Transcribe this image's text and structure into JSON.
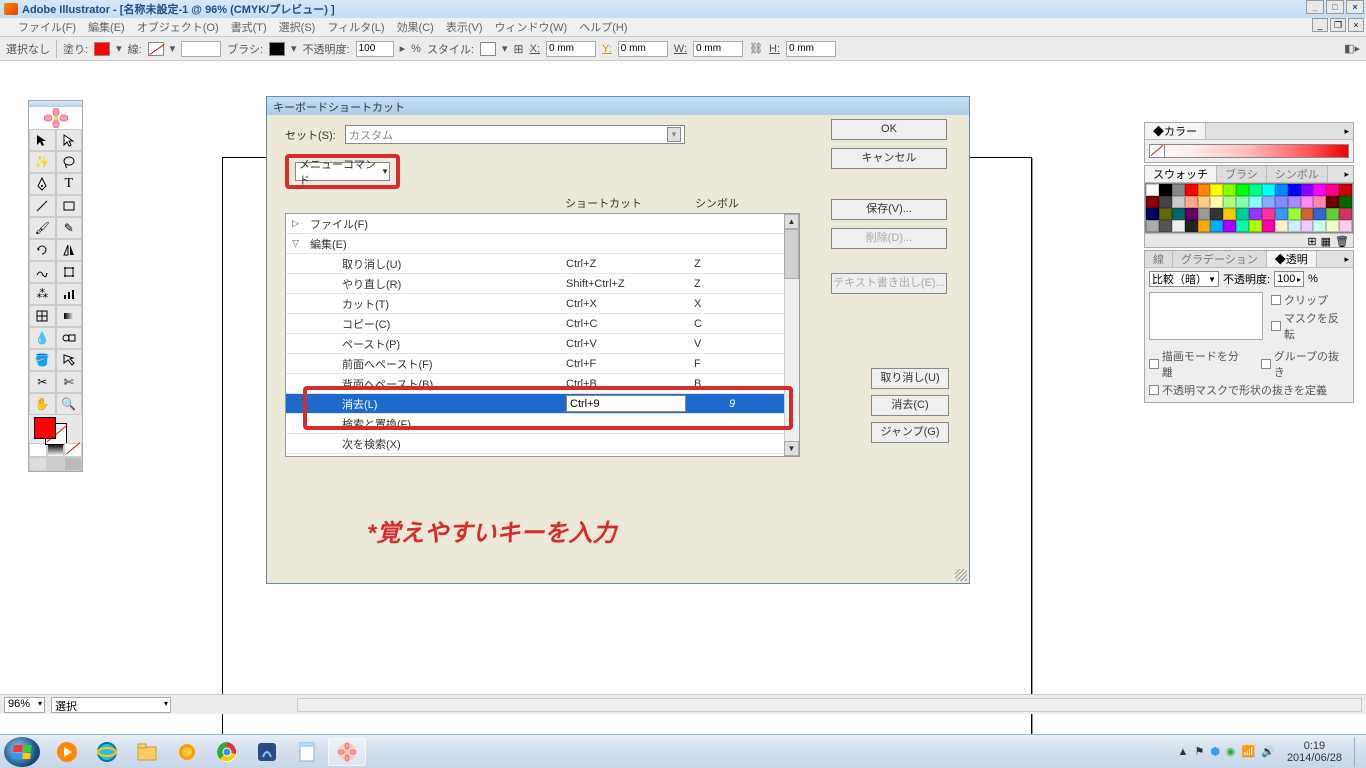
{
  "titlebar": {
    "text": "Adobe Illustrator - [名称未設定-1 @ 96% (CMYK/プレビュー) ]"
  },
  "menu": {
    "file": "ファイル(F)",
    "edit": "編集(E)",
    "object": "オブジェクト(O)",
    "type": "書式(T)",
    "select": "選択(S)",
    "filter": "フィルタ(L)",
    "effect": "効果(C)",
    "view": "表示(V)",
    "window": "ウィンドウ(W)",
    "help": "ヘルプ(H)"
  },
  "controlbar": {
    "nosel": "選択なし",
    "fill": "塗り:",
    "stroke": "線:",
    "brush": "ブラシ:",
    "opacity_lbl": "不透明度:",
    "opacity_val": "100",
    "pct": "%",
    "style": "スタイル:",
    "x": "X:",
    "y": "Y:",
    "w": "W:",
    "h": "H:",
    "zero": "0 mm"
  },
  "dialog": {
    "title": "キーボードショートカット",
    "set_lbl": "セット(S):",
    "set_val": "カスタム",
    "type_dd": "メニューコマンド",
    "col_sc": "ショートカット",
    "col_sym": "シンボル",
    "btn_ok": "OK",
    "btn_cancel": "キャンセル",
    "btn_save": "保存(V)...",
    "btn_delete": "削除(D)...",
    "btn_text": "テキスト書き出し(E)...",
    "rows": [
      {
        "exp": "▷",
        "name": "ファイル(F)",
        "sc": "",
        "sym": "",
        "group": true
      },
      {
        "exp": "▽",
        "name": "編集(E)",
        "sc": "",
        "sym": "",
        "group": true
      },
      {
        "name": "取り消し(U)",
        "sc": "Ctrl+Z",
        "sym": "Z",
        "indent": true
      },
      {
        "name": "やり直し(R)",
        "sc": "Shift+Ctrl+Z",
        "sym": "Z",
        "indent": true
      },
      {
        "name": "カット(T)",
        "sc": "Ctrl+X",
        "sym": "X",
        "indent": true
      },
      {
        "name": "コピー(C)",
        "sc": "Ctrl+C",
        "sym": "C",
        "indent": true
      },
      {
        "name": "ペースト(P)",
        "sc": "Ctrl+V",
        "sym": "V",
        "indent": true
      },
      {
        "name": "前面へペースト(F)",
        "sc": "Ctrl+F",
        "sym": "F",
        "indent": true
      },
      {
        "name": "背面へペースト(B)",
        "sc": "Ctrl+B",
        "sym": "B",
        "indent": true
      },
      {
        "name": "消去(L)",
        "sc": "Ctrl+9",
        "sym": "9",
        "indent": true,
        "sel": true
      },
      {
        "name": "検索と置換(F)",
        "sc": "",
        "sym": "",
        "indent": true
      },
      {
        "name": "次を検索(X)",
        "sc": "",
        "sym": "",
        "indent": true
      }
    ],
    "btn_undo": "取り消し(U)",
    "btn_clear": "消去(C)",
    "btn_jump": "ジャンプ(G)",
    "annot": "*覚えやすいキーを入力"
  },
  "status": {
    "zoom": "96%",
    "mode": "選択"
  },
  "panels": {
    "color_tab": "◆カラー",
    "swatch": "スウォッチ",
    "brush": "ブラシ",
    "symbol": "シンボル",
    "stroke": "線",
    "grad": "グラデーション",
    "trans": "◆透明",
    "blend": "比較（暗）",
    "opacity_lbl": "不透明度:",
    "opacity_val": "100",
    "pct": "%",
    "chk_clip": "クリップ",
    "chk_mask_inv": "マスクを反転",
    "chk_isolate": "描画モードを分離",
    "chk_knockout": "グループの抜き",
    "chk_opmask": "不透明マスクで形状の抜きを定義"
  },
  "taskbar": {
    "time": "0:19",
    "date": "2014/06/28"
  }
}
